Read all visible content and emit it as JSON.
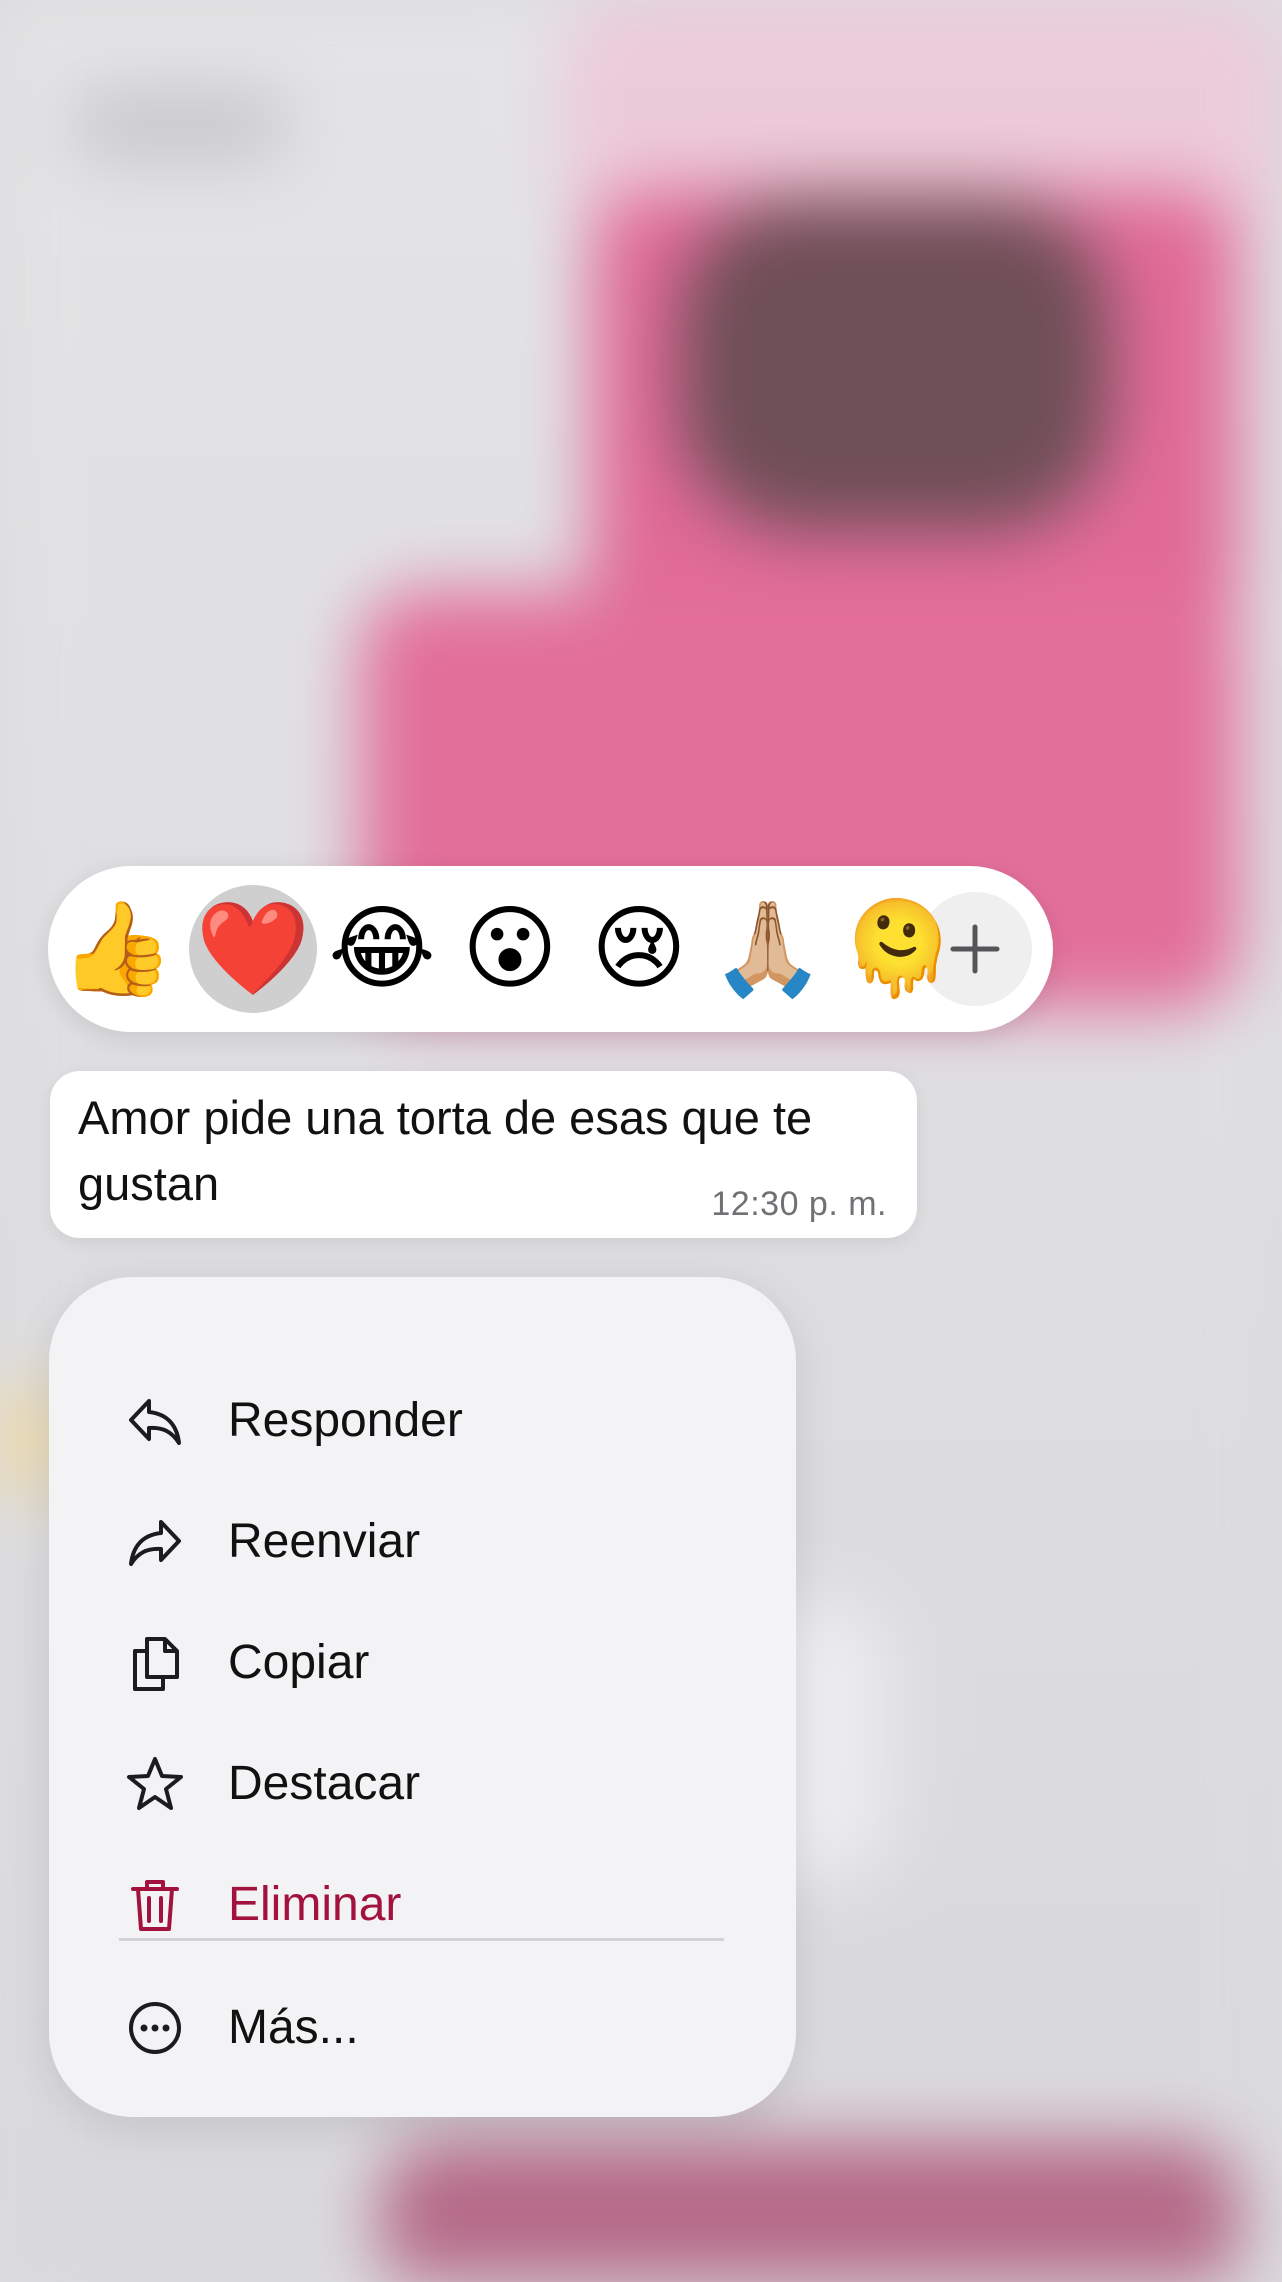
{
  "reaction_bar": {
    "emojis": [
      {
        "name": "thumbs-up",
        "glyph": "👍",
        "selected": false
      },
      {
        "name": "red-heart",
        "glyph": "❤️",
        "selected": true
      },
      {
        "name": "tears-of-joy",
        "glyph": "😂",
        "selected": false
      },
      {
        "name": "open-mouth",
        "glyph": "😮",
        "selected": false
      },
      {
        "name": "crying",
        "glyph": "😢",
        "selected": false
      },
      {
        "name": "folded-hands",
        "glyph": "🙏🏼",
        "selected": false
      },
      {
        "name": "melting-face",
        "glyph": "🫠",
        "selected": false
      }
    ],
    "more_icon": "plus-icon"
  },
  "message": {
    "text": "Amor pide una torta de esas que te gustan",
    "time": "12:30 p. m."
  },
  "menu": {
    "items": [
      {
        "label": "Responder",
        "icon": "reply-icon"
      },
      {
        "label": "Reenviar",
        "icon": "forward-icon"
      },
      {
        "label": "Copiar",
        "icon": "copy-icon"
      },
      {
        "label": "Destacar",
        "icon": "star-icon"
      },
      {
        "label": "Eliminar",
        "icon": "trash-icon"
      }
    ],
    "more": {
      "label": "Más...",
      "icon": "more-circle-icon"
    }
  },
  "colors": {
    "danger": "#a3123d",
    "bubble": "#ffffff",
    "menu_background": "#f4f4f6"
  }
}
